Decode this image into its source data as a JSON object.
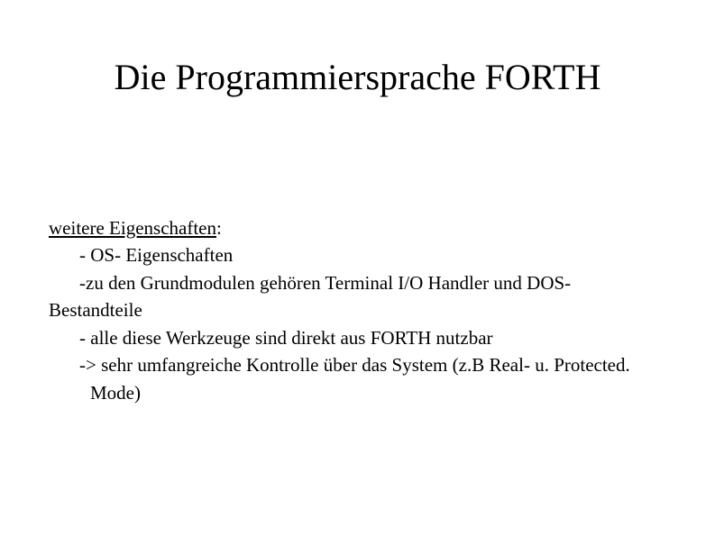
{
  "title": "Die Programmiersprache FORTH",
  "subheading": "weitere Eigenschaften",
  "subheading_colon": ":",
  "lines": {
    "l1": "- OS- Eigenschaften",
    "l2": "-zu den Grundmodulen gehören Terminal I/O Handler und DOS-",
    "l2b": "Bestandteile",
    "l3": "- alle diese Werkzeuge sind direkt aus FORTH nutzbar",
    "l4": "-> sehr umfangreiche Kontrolle über das System (z.B Real- u. Protected.",
    "l4b": "Mode)"
  }
}
